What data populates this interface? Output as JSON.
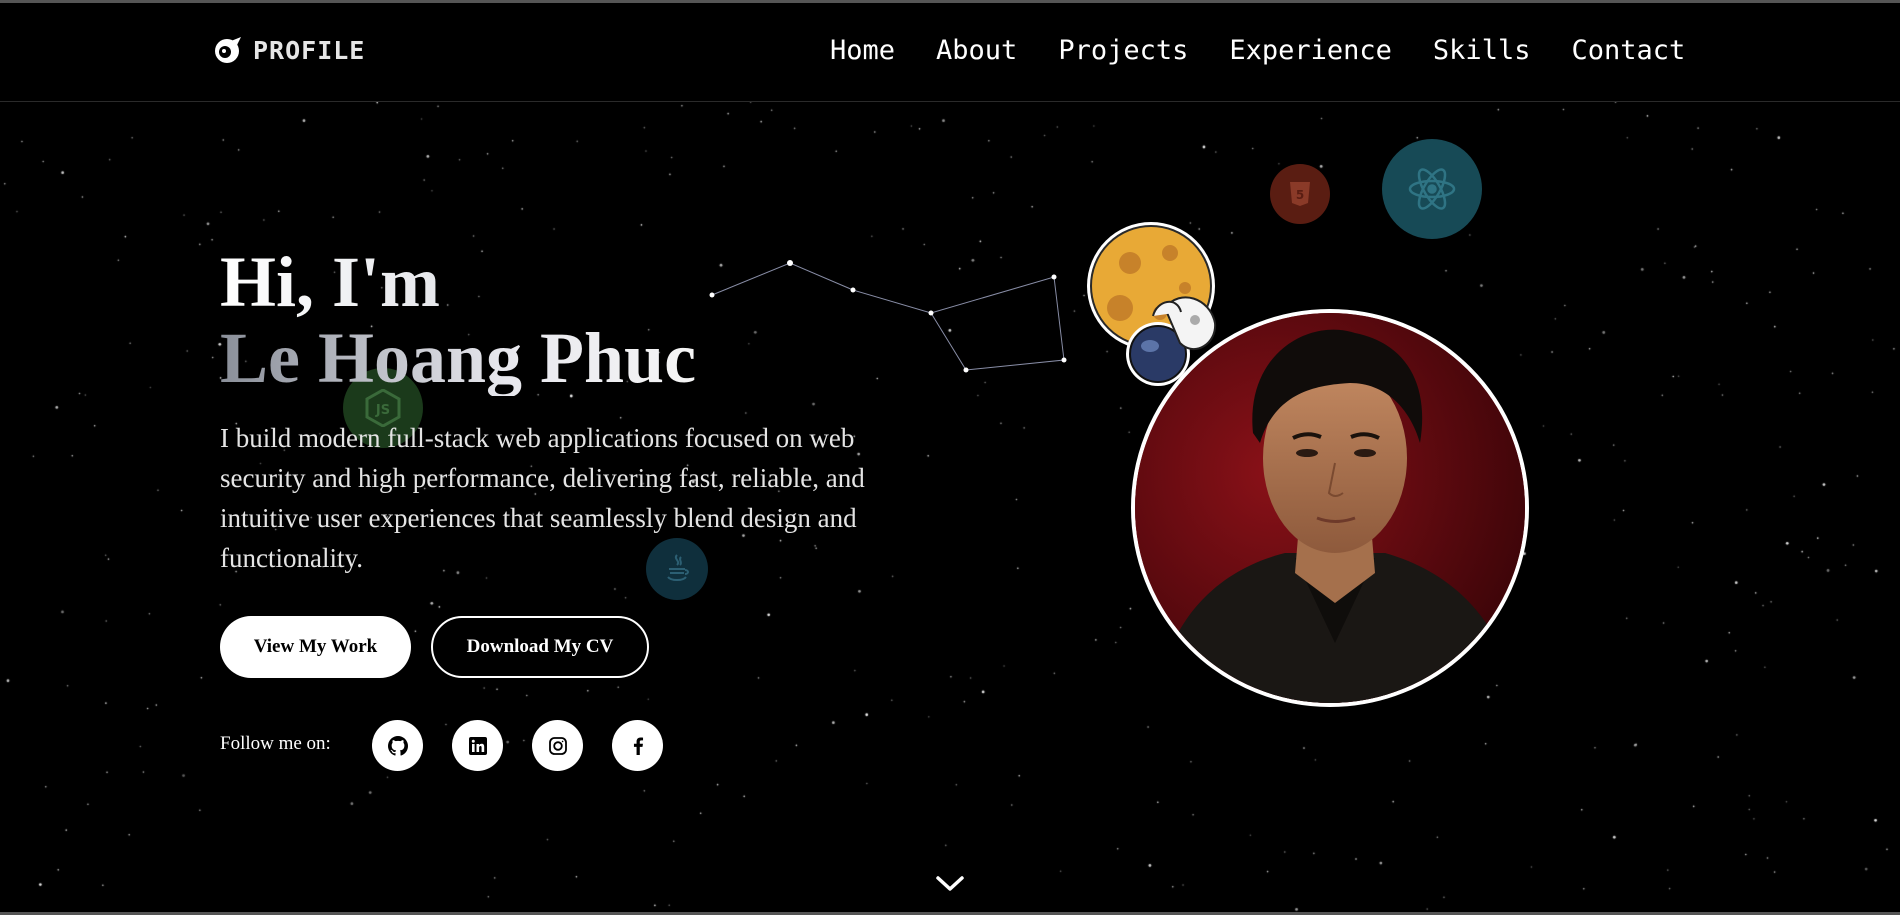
{
  "brand": {
    "name": "PROFILE",
    "icon": "astronaut-logo-icon"
  },
  "nav": {
    "items": [
      "Home",
      "About",
      "Projects",
      "Experience",
      "Skills",
      "Contact"
    ]
  },
  "hero": {
    "greeting": "Hi, I'm",
    "name": "Le Hoang Phuc",
    "description": "I build modern full-stack web applications focused on web security and high performance, delivering fast, reliable, and intuitive user experiences that seamlessly blend design and functionality.",
    "primary_button": "View My Work",
    "secondary_button": "Download My CV",
    "follow_label": "Follow me on:"
  },
  "social": [
    "github-icon",
    "linkedin-icon",
    "instagram-icon",
    "facebook-icon"
  ],
  "floating_icons": [
    "html5-icon",
    "react-icon",
    "nodejs-icon",
    "java-icon"
  ],
  "colors": {
    "background": "#000000",
    "text": "#ffffff",
    "avatar_bg": "#6b0c12"
  }
}
